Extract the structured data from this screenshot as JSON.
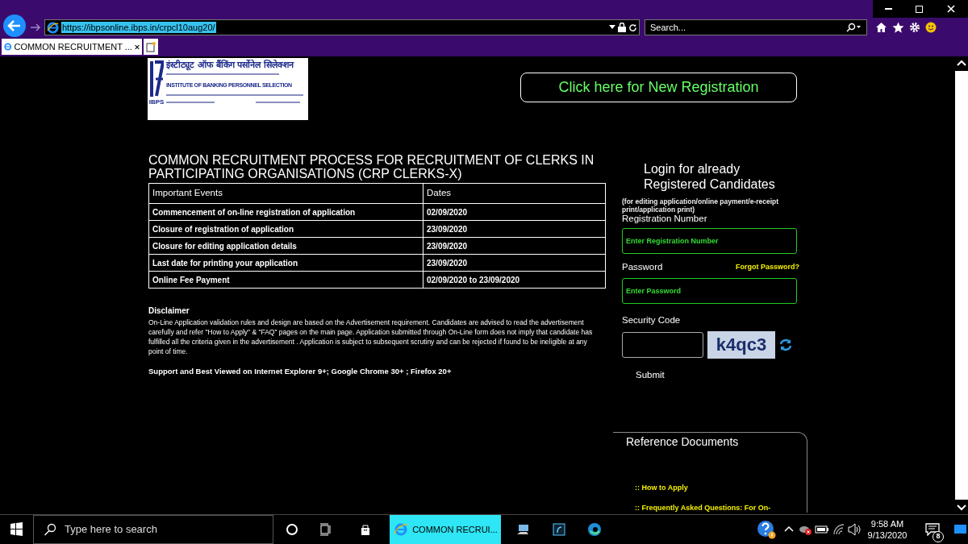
{
  "browser": {
    "url": "https://ibpsonline.ibps.in/crpcl10aug20/",
    "search_placeholder": "Search...",
    "tabs": [
      {
        "title": "COMMON RECRUITMENT ...",
        "selected": true
      }
    ]
  },
  "logo": {
    "hindi_title": "इंस्टीट्यूट ऑफ बैंकिंग पर्सोनेल सिलेक्शन",
    "english_title": "INSTITUTE OF BANKING PERSONNEL SELECTION",
    "abbr": "IBPS"
  },
  "register_button": "Click here for New Registration",
  "heading": "COMMON RECRUITMENT PROCESS FOR RECRUITMENT OF CLERKS IN PARTICIPATING ORGANISATIONS (CRP CLERKS-X)",
  "table": {
    "columns": [
      "Important Events",
      "Dates"
    ],
    "rows": [
      [
        "Commencement of on-line registration of application",
        "02/09/2020"
      ],
      [
        "Closure of registration of application",
        "23/09/2020"
      ],
      [
        "Closure for editing application details",
        "23/09/2020"
      ],
      [
        "Last date for printing your application",
        "23/09/2020"
      ],
      [
        "Online Fee Payment",
        "02/09/2020 to 23/09/2020"
      ]
    ]
  },
  "disclaimer": {
    "title": "Disclaimer",
    "text": "On-Line Application validation rules and design are based on the Advertisement requirement. Candidates are advised to read the advertisement carefully and refer \"How to Apply\" & \"FAQ\" pages on the main page. Application submitted through On-Line form does not imply that candidate has fulfilled all the criteria given in the advertisement . Application is subject to subsequent scrutiny and can be rejected if found to be ineligible at any point of time."
  },
  "support_note": "Support and Best Viewed on Internet Explorer 9+; Google Chrome 30+ ; Firefox 20+",
  "login": {
    "title": "Login for already Registered Candidates",
    "subtitle": "(for editing application/online payment/e-receipt print/application print)",
    "registration_label": "Registration Number",
    "registration_placeholder": "Enter Registration Number",
    "password_label": "Password",
    "forgot_link": "Forgot Password?",
    "password_placeholder": "Enter Password",
    "security_label": "Security Code",
    "captcha_text": "k4qc3",
    "submit": "Submit"
  },
  "reference": {
    "title": "Reference Documents",
    "links": [
      ":: How to Apply",
      ":: Frequently Asked Questions: For On-"
    ]
  },
  "taskbar": {
    "search_placeholder": "Type here to search",
    "apps": [
      {
        "kind": "cortana",
        "selected": false
      },
      {
        "kind": "taskview",
        "selected": false
      },
      {
        "kind": "store",
        "selected": false
      },
      {
        "kind": "ie",
        "label": "COMMON RECRUI...",
        "selected": true
      },
      {
        "kind": "computer",
        "selected": false
      },
      {
        "kind": "app",
        "selected": false
      },
      {
        "kind": "edge",
        "selected": false
      }
    ],
    "time": "9:58 AM",
    "date": "9/13/2020",
    "notifications": "8"
  }
}
